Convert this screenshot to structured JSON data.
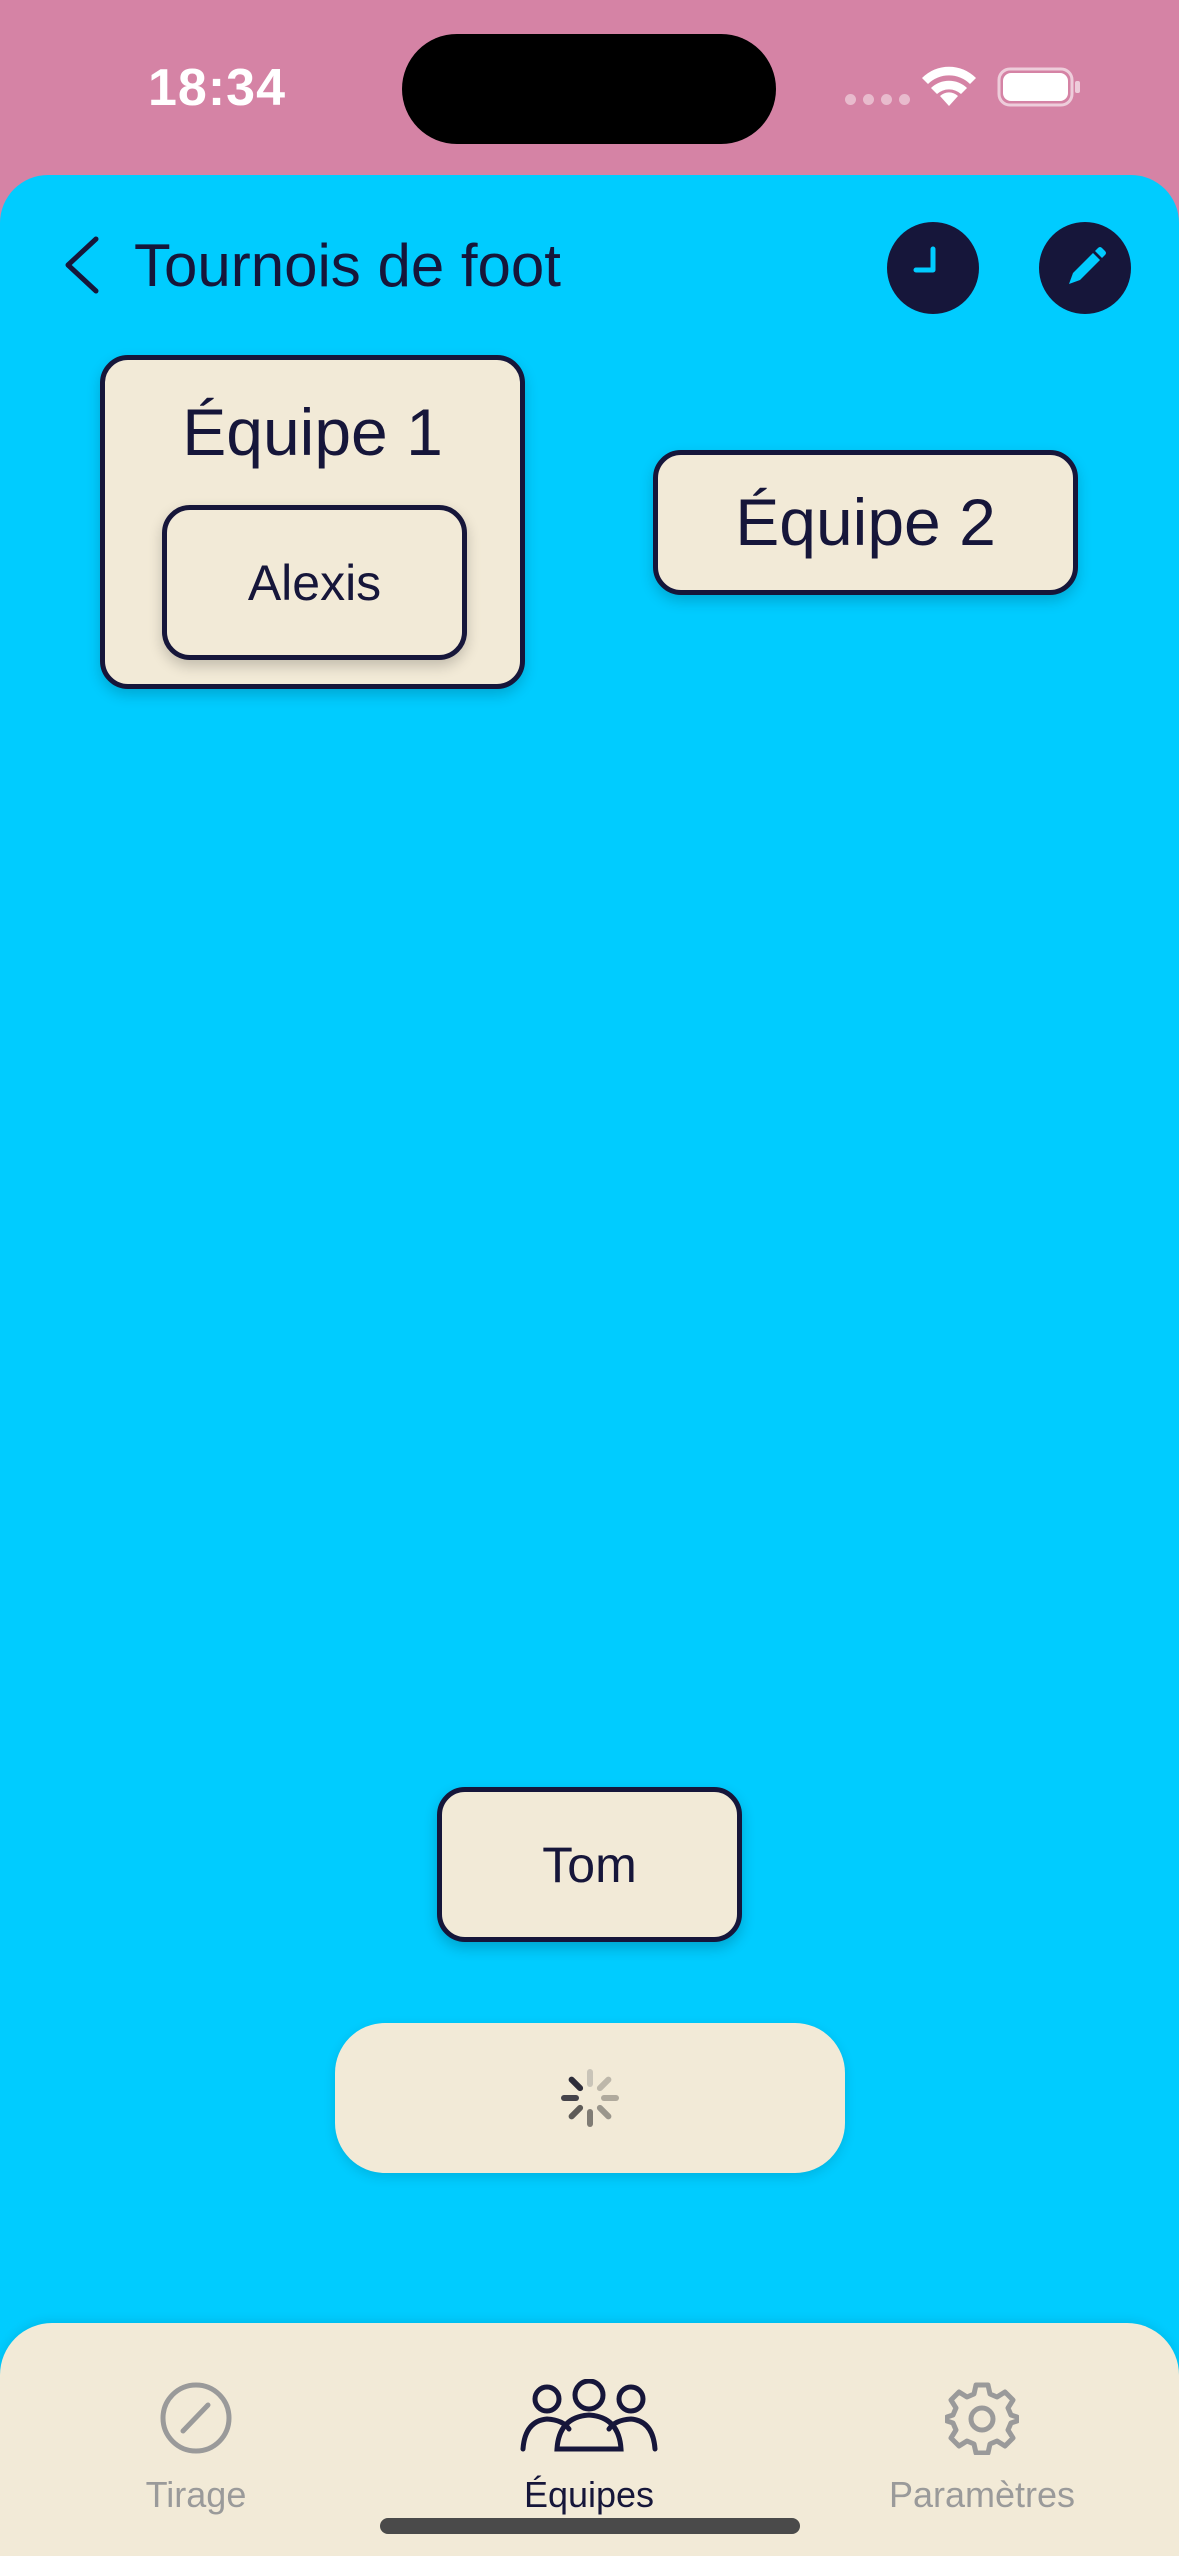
{
  "status_bar": {
    "time": "18:34",
    "icons": [
      "signal-icon",
      "wifi-icon",
      "battery-icon"
    ]
  },
  "nav": {
    "title": "Tournois de foot",
    "back_icon": "chevron-left-icon",
    "actions": [
      "clock-icon",
      "pencil-icon"
    ]
  },
  "teams": [
    {
      "name": "Équipe 1",
      "players": [
        "Alexis"
      ]
    },
    {
      "name": "Équipe 2",
      "players": []
    }
  ],
  "unassigned_players": [
    "Tom"
  ],
  "loading": {
    "icon": "spinner-icon"
  },
  "tab_bar": {
    "tabs": [
      {
        "label": "Tirage",
        "icon": "compass-pencil-icon",
        "active": false
      },
      {
        "label": "Équipes",
        "icon": "people-icon",
        "active": true
      },
      {
        "label": "Paramètres",
        "icon": "gear-icon",
        "active": false
      }
    ]
  },
  "colors": {
    "status_bar_bg": "#D583A5",
    "screen_bg": "#00CCFF",
    "card_bg": "#F2EAD7",
    "ink": "#16163A",
    "inactive_tab": "#9A9A9A"
  }
}
